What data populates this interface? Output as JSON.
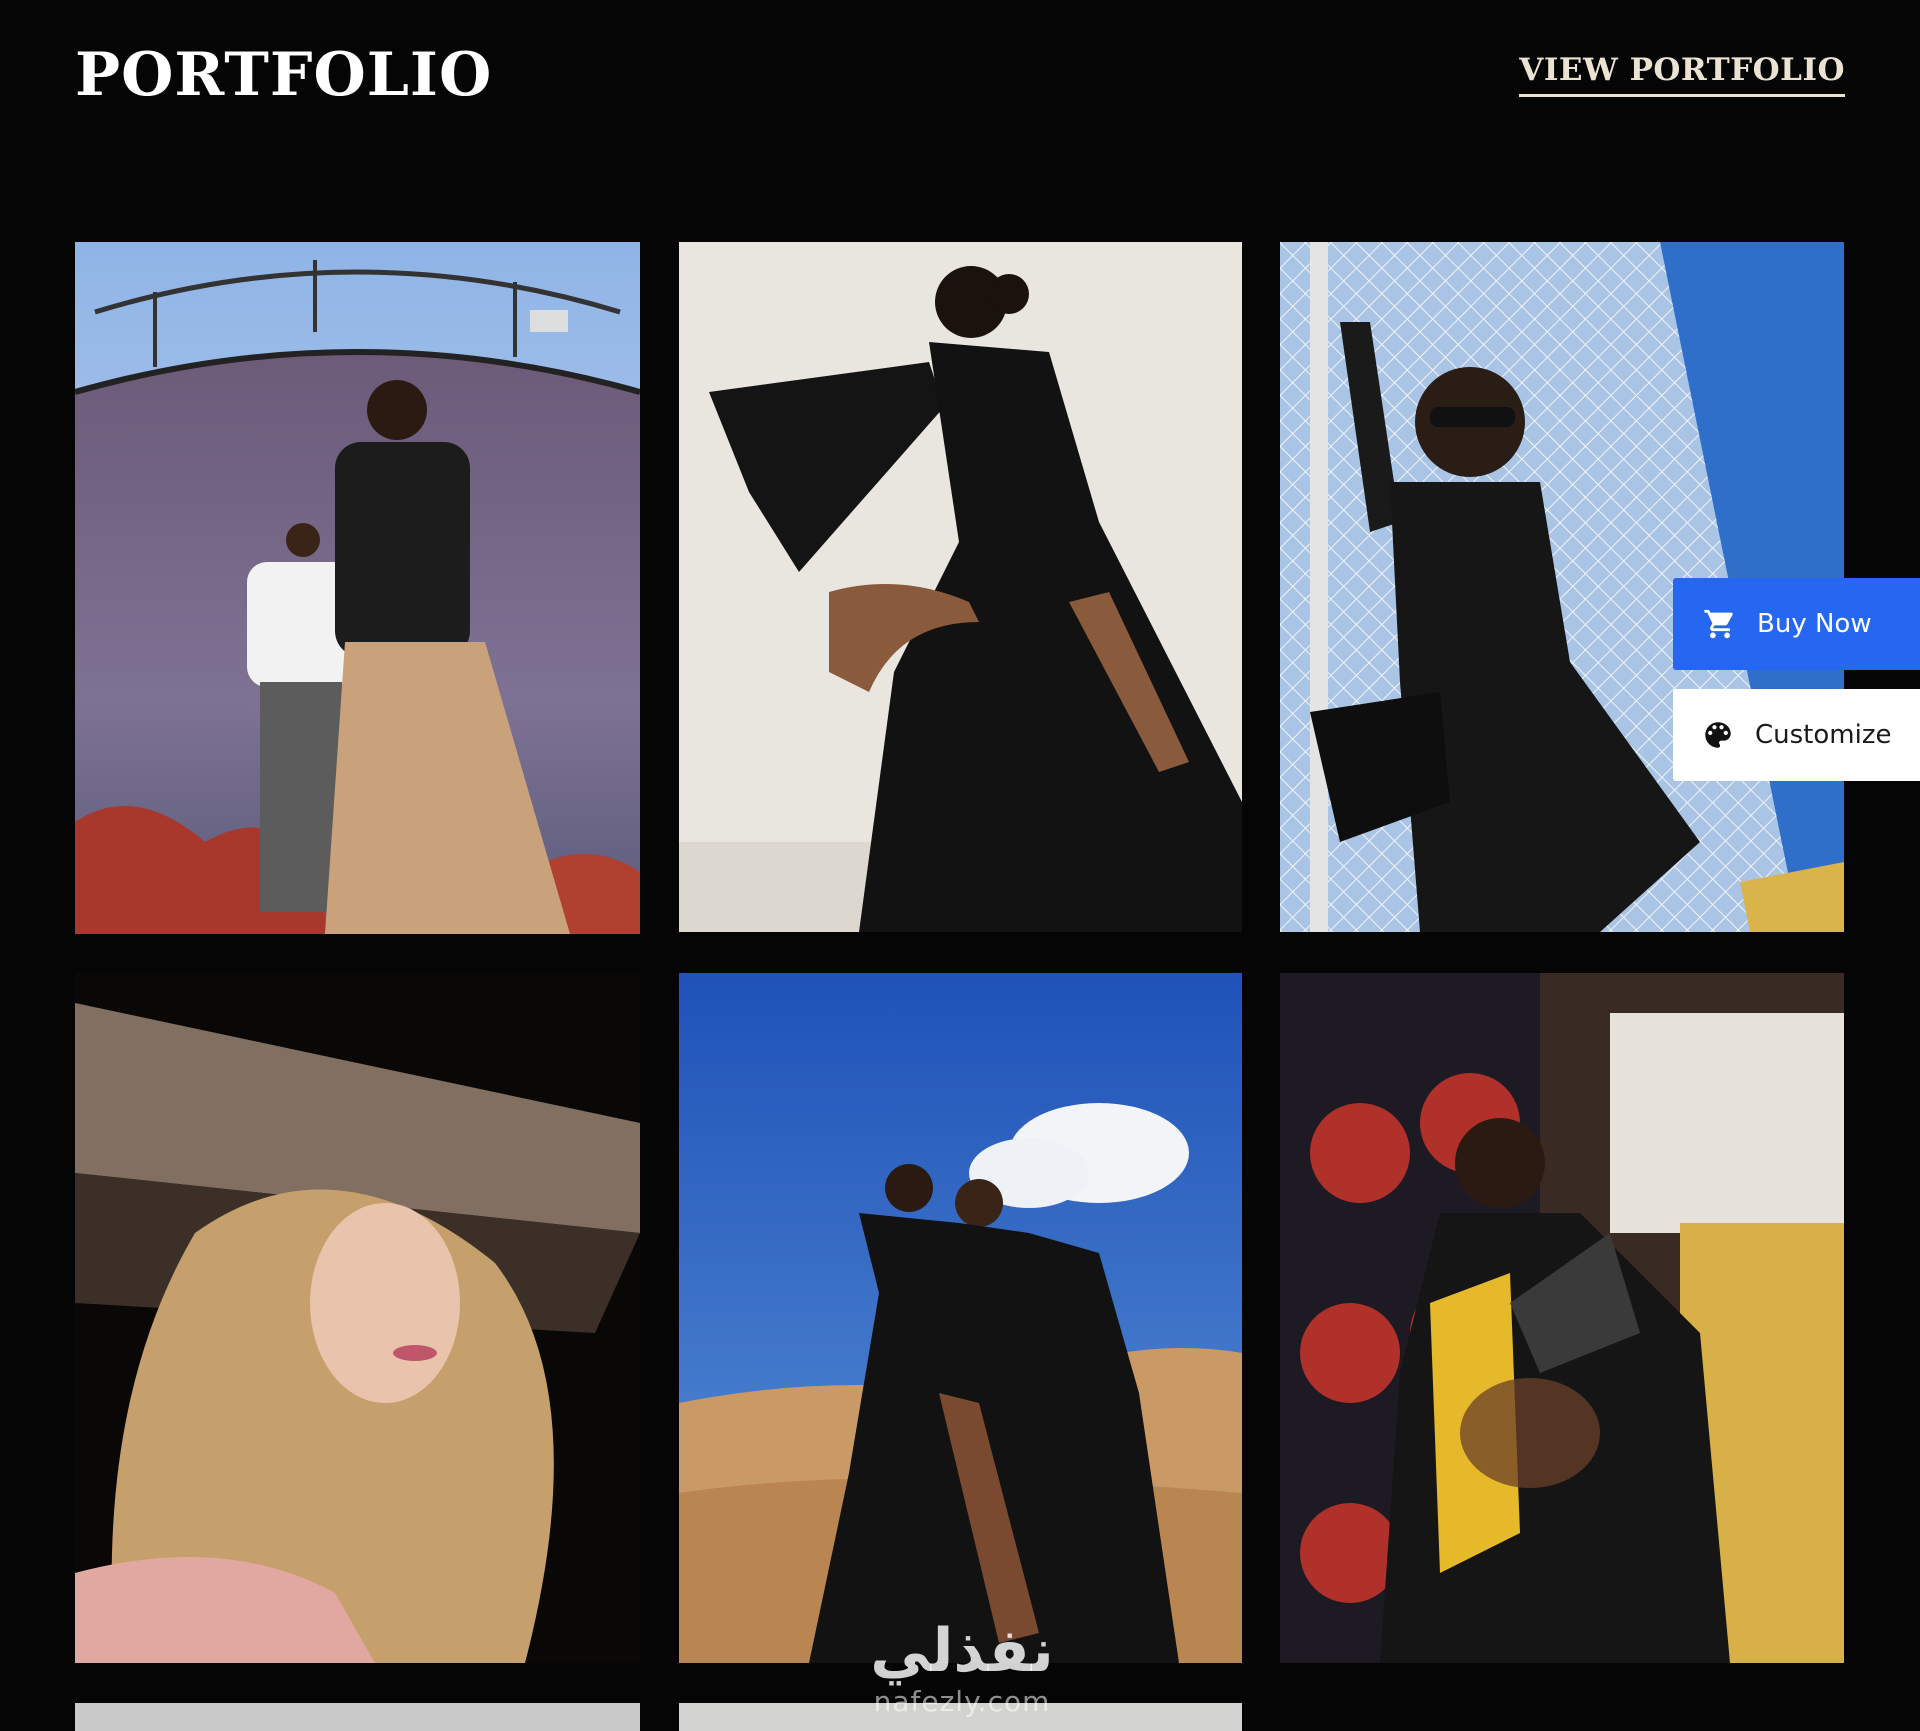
{
  "header": {
    "title": "PORTFOLIO",
    "view_link": "VIEW PORTFOLIO"
  },
  "gallery": {
    "photos": [
      {
        "subject": "two men posing in front of a purple industrial tank"
      },
      {
        "subject": "woman in black bell-sleeve dress on white backdrop"
      },
      {
        "subject": "woman in sunglasses and leather outfit by a net fence"
      },
      {
        "subject": "blonde woman portrait under a draped veil"
      },
      {
        "subject": "couple in black outfits in a desert"
      },
      {
        "subject": "man reaching toward camera before a poster wall"
      }
    ]
  },
  "floating_actions": {
    "buy_label": "Buy Now",
    "buy_icon": "cart-icon",
    "customize_label": "Customize",
    "customize_icon": "palette-icon",
    "buy_color": "#2567f0"
  },
  "watermark": {
    "arabic": "نفذلي",
    "latin": "nafezly.com"
  }
}
